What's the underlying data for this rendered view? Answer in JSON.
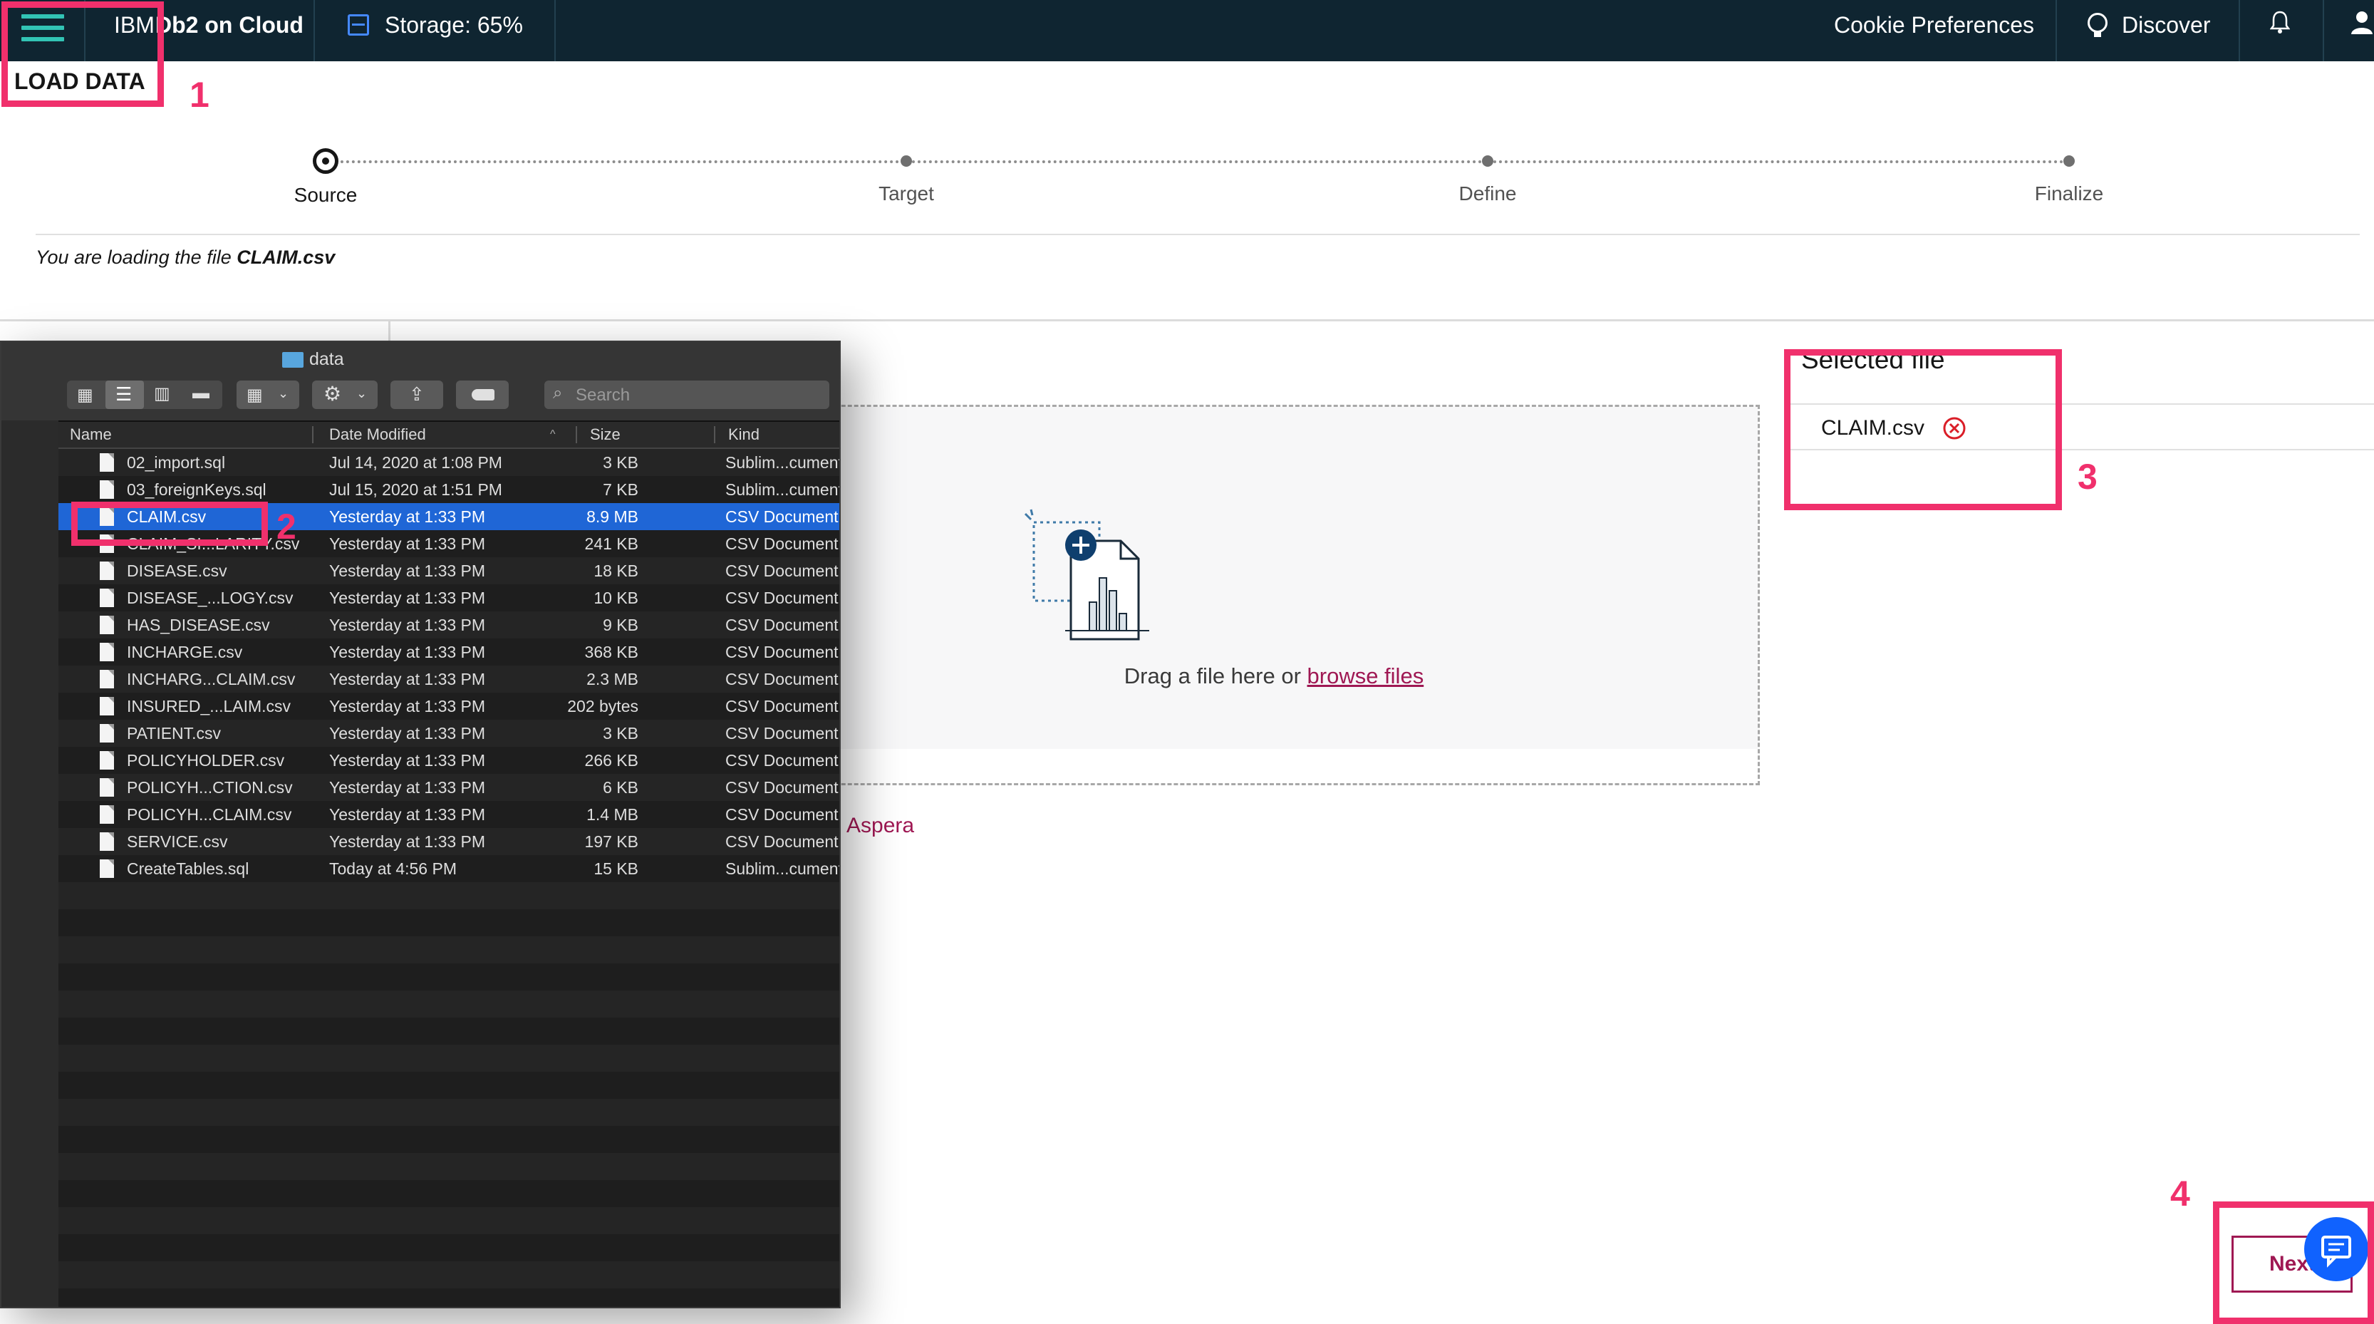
{
  "topbar": {
    "brand_prefix": "IBM",
    "brand_name": "Db2 on Cloud",
    "storage": "Storage: 65%",
    "cookie": "Cookie Preferences",
    "discover": "Discover"
  },
  "page": {
    "title": "LOAD DATA",
    "loading_prefix": "You are loading the file ",
    "loading_file": "CLAIM.csv"
  },
  "steps": [
    "Source",
    "Target",
    "Define",
    "Finalize"
  ],
  "dropzone": {
    "text": "Drag a file here or ",
    "browse": "browse files",
    "aspera": "Aspera"
  },
  "selected": {
    "heading": "Selected file",
    "file": "CLAIM.csv"
  },
  "next_button": "Next",
  "annotations": [
    "1",
    "2",
    "3",
    "4"
  ],
  "finder": {
    "title": "data",
    "search_placeholder": "Search",
    "columns": [
      "Name",
      "Date Modified",
      "Size",
      "Kind"
    ],
    "files": [
      {
        "name": "02_import.sql",
        "date": "Jul 14, 2020 at 1:08 PM",
        "size": "3 KB",
        "kind": "Sublim...cument"
      },
      {
        "name": "03_foreignKeys.sql",
        "date": "Jul 15, 2020 at 1:51 PM",
        "size": "7 KB",
        "kind": "Sublim...cument"
      },
      {
        "name": "CLAIM.csv",
        "date": "Yesterday at 1:33 PM",
        "size": "8.9 MB",
        "kind": "CSV Document",
        "selected": true
      },
      {
        "name": "CLAIM_SI...LARITY.csv",
        "date": "Yesterday at 1:33 PM",
        "size": "241 KB",
        "kind": "CSV Document"
      },
      {
        "name": "DISEASE.csv",
        "date": "Yesterday at 1:33 PM",
        "size": "18 KB",
        "kind": "CSV Document"
      },
      {
        "name": "DISEASE_...LOGY.csv",
        "date": "Yesterday at 1:33 PM",
        "size": "10 KB",
        "kind": "CSV Document"
      },
      {
        "name": "HAS_DISEASE.csv",
        "date": "Yesterday at 1:33 PM",
        "size": "9 KB",
        "kind": "CSV Document"
      },
      {
        "name": "INCHARGE.csv",
        "date": "Yesterday at 1:33 PM",
        "size": "368 KB",
        "kind": "CSV Document"
      },
      {
        "name": "INCHARG...CLAIM.csv",
        "date": "Yesterday at 1:33 PM",
        "size": "2.3 MB",
        "kind": "CSV Document"
      },
      {
        "name": "INSURED_...LAIM.csv",
        "date": "Yesterday at 1:33 PM",
        "size": "202 bytes",
        "kind": "CSV Document"
      },
      {
        "name": "PATIENT.csv",
        "date": "Yesterday at 1:33 PM",
        "size": "3 KB",
        "kind": "CSV Document"
      },
      {
        "name": "POLICYHOLDER.csv",
        "date": "Yesterday at 1:33 PM",
        "size": "266 KB",
        "kind": "CSV Document"
      },
      {
        "name": "POLICYH...CTION.csv",
        "date": "Yesterday at 1:33 PM",
        "size": "6 KB",
        "kind": "CSV Document"
      },
      {
        "name": "POLICYH...CLAIM.csv",
        "date": "Yesterday at 1:33 PM",
        "size": "1.4 MB",
        "kind": "CSV Document"
      },
      {
        "name": "SERVICE.csv",
        "date": "Yesterday at 1:33 PM",
        "size": "197 KB",
        "kind": "CSV Document"
      },
      {
        "name": "CreateTables.sql",
        "date": "Today at 4:56 PM",
        "size": "15 KB",
        "kind": "Sublim...cument"
      }
    ]
  }
}
